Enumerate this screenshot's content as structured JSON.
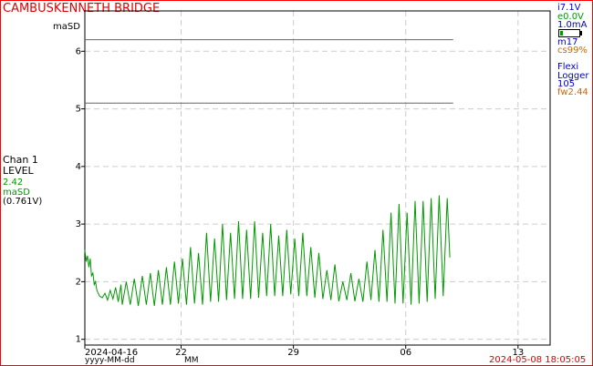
{
  "header": {
    "title": "CAMBUSKENNETH BRIDGE",
    "unit_top": "maSD"
  },
  "status": {
    "items": [
      {
        "text": "i7.1V",
        "color": "#0000cc"
      },
      {
        "text": "e0.0V",
        "color": "#009900"
      },
      {
        "text": "1.0mA",
        "color": "#0000cc"
      }
    ],
    "battery_level": 0.15,
    "items2": [
      {
        "text": "m17",
        "color": "#0000cc"
      },
      {
        "text": "cs99%",
        "color": "#cc6600"
      }
    ],
    "logger": [
      {
        "text": "Flexi",
        "color": "#0000cc"
      },
      {
        "text": "Logger",
        "color": "#0000cc"
      },
      {
        "text": "105",
        "color": "#0000cc"
      },
      {
        "text": "fw2.44",
        "color": "#cc6600"
      }
    ]
  },
  "channel": {
    "name": "Chan 1",
    "label": "LEVEL",
    "value": "2.42",
    "unit": "maSD",
    "voltage": "(0.761V)"
  },
  "footer": {
    "x_format": "yyyy-MM-dd",
    "x_format2": "MM",
    "timestamp": "2024-05-08 18:05:05"
  },
  "chart_data": {
    "type": "line",
    "ylim": [
      0.9,
      6.7
    ],
    "xlim": [
      "2024-04-16",
      "2024-05-15"
    ],
    "y_ticks": [
      1,
      2,
      3,
      4,
      5,
      6
    ],
    "x_ticks": [
      {
        "date": "2024-04-16",
        "label": "2024-04-16"
      },
      {
        "date": "2024-04-22",
        "label": "22"
      },
      {
        "date": "2024-04-29",
        "label": "29"
      },
      {
        "date": "2024-05-06",
        "label": "06"
      },
      {
        "date": "2024-05-13",
        "label": "13"
      }
    ],
    "grid": true,
    "threshold_lines": [
      6.2,
      5.1
    ],
    "threshold_end": "2024-05-08 23:00",
    "series_color": "#009900",
    "series": [
      {
        "x": [
          "2024-04-16 00:00",
          "2024-04-16 02:00",
          "2024-04-16 04:00",
          "2024-04-16 06:00",
          "2024-04-16 08:00",
          "2024-04-16 10:00",
          "2024-04-16 12:00",
          "2024-04-16 14:00",
          "2024-04-16 16:00",
          "2024-04-16 18:00",
          "2024-04-16 20:00",
          "2024-04-16 22:00",
          "2024-04-17 02:00",
          "2024-04-17 06:00",
          "2024-04-17 10:00",
          "2024-04-17 14:00",
          "2024-04-17 18:00",
          "2024-04-17 22:00",
          "2024-04-18 02:00",
          "2024-04-18 06:00",
          "2024-04-18 08:00",
          "2024-04-18 14:00",
          "2024-04-18 20:00",
          "2024-04-19 02:00",
          "2024-04-19 08:00",
          "2024-04-19 14:00",
          "2024-04-19 20:00",
          "2024-04-20 02:00",
          "2024-04-20 08:00",
          "2024-04-20 14:00",
          "2024-04-20 20:00",
          "2024-04-21 02:00",
          "2024-04-21 08:00",
          "2024-04-21 14:00",
          "2024-04-21 20:00",
          "2024-04-22 02:00",
          "2024-04-22 08:00",
          "2024-04-22 14:00",
          "2024-04-22 20:00",
          "2024-04-23 02:00",
          "2024-04-23 08:00",
          "2024-04-23 14:00",
          "2024-04-23 20:00",
          "2024-04-24 02:00",
          "2024-04-24 08:00",
          "2024-04-24 14:00",
          "2024-04-24 20:00",
          "2024-04-25 02:00",
          "2024-04-25 08:00",
          "2024-04-25 14:00",
          "2024-04-25 20:00",
          "2024-04-26 02:00",
          "2024-04-26 08:00",
          "2024-04-26 14:00",
          "2024-04-26 20:00",
          "2024-04-27 02:00",
          "2024-04-27 08:00",
          "2024-04-27 14:00",
          "2024-04-27 20:00",
          "2024-04-28 02:00",
          "2024-04-28 08:00",
          "2024-04-28 14:00",
          "2024-04-28 20:00",
          "2024-04-29 02:00",
          "2024-04-29 08:00",
          "2024-04-29 14:00",
          "2024-04-29 20:00",
          "2024-04-30 02:00",
          "2024-04-30 08:00",
          "2024-04-30 14:00",
          "2024-04-30 20:00",
          "2024-05-01 02:00",
          "2024-05-01 08:00",
          "2024-05-01 14:00",
          "2024-05-01 20:00",
          "2024-05-02 02:00",
          "2024-05-02 08:00",
          "2024-05-02 14:00",
          "2024-05-02 20:00",
          "2024-05-03 02:00",
          "2024-05-03 08:00",
          "2024-05-03 14:00",
          "2024-05-03 20:00",
          "2024-05-04 02:00",
          "2024-05-04 08:00",
          "2024-05-04 14:00",
          "2024-05-04 20:00",
          "2024-05-05 02:00",
          "2024-05-05 08:00",
          "2024-05-05 14:00",
          "2024-05-05 20:00",
          "2024-05-06 02:00",
          "2024-05-06 08:00",
          "2024-05-06 14:00",
          "2024-05-06 20:00",
          "2024-05-07 02:00",
          "2024-05-07 08:00",
          "2024-05-07 14:00",
          "2024-05-07 20:00",
          "2024-05-08 02:00",
          "2024-05-08 08:00",
          "2024-05-08 14:00",
          "2024-05-08 18:00"
        ],
        "values": [
          2.55,
          2.35,
          2.45,
          2.25,
          2.4,
          2.1,
          2.15,
          1.95,
          2.0,
          1.85,
          1.8,
          1.75,
          1.72,
          1.8,
          1.68,
          1.85,
          1.7,
          1.9,
          1.65,
          1.95,
          1.6,
          2.0,
          1.6,
          2.05,
          1.58,
          2.1,
          1.6,
          2.15,
          1.58,
          2.2,
          1.6,
          2.25,
          1.6,
          2.35,
          1.62,
          2.4,
          1.6,
          2.6,
          1.62,
          2.5,
          1.6,
          2.85,
          1.65,
          2.75,
          1.65,
          3.0,
          1.68,
          2.85,
          1.7,
          3.05,
          1.7,
          2.9,
          1.7,
          3.05,
          1.72,
          2.85,
          1.75,
          3.0,
          1.75,
          2.8,
          1.75,
          2.9,
          1.78,
          2.75,
          1.75,
          2.85,
          1.75,
          2.6,
          1.72,
          2.5,
          1.7,
          2.2,
          1.68,
          2.3,
          1.66,
          2.0,
          1.68,
          2.15,
          1.66,
          2.05,
          1.65,
          2.35,
          1.68,
          2.55,
          1.65,
          2.9,
          1.65,
          3.2,
          1.62,
          3.35,
          1.62,
          3.2,
          1.6,
          3.4,
          1.62,
          3.4,
          1.65,
          3.45,
          1.7,
          3.5,
          1.75,
          3.45,
          2.42
        ]
      }
    ]
  }
}
